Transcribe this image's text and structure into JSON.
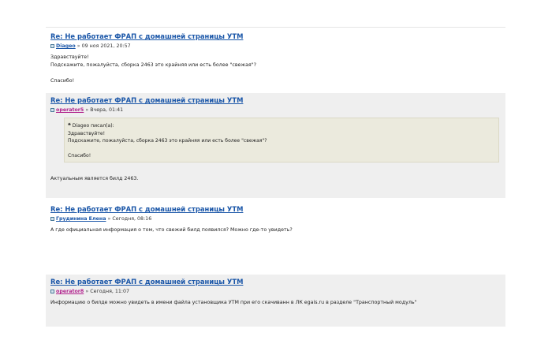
{
  "posts": [
    {
      "title": "Re: Не работает ФРАП с домашней страницы УТМ",
      "author": "Diageo",
      "date_sep": "»",
      "date": "09 ноя 2021, 20:57",
      "body": [
        "Здравствуйте!",
        "Подскажите, пожалуйста, сборка 2463 это крайняя или есть более \"свежая\"?",
        "",
        "Спасибо!"
      ]
    },
    {
      "title": "Re: Не работает ФРАП с домашней страницы УТМ",
      "author": "operator5",
      "date_sep": "»",
      "date": "Вчера, 01:41",
      "quote": {
        "header": "Diageo писал(а):",
        "lines": [
          "Здравствуйте!",
          "Подскажите, пожалуйста, сборка 2463 это крайняя или есть более \"свежая\"?",
          "",
          "Спасибо!"
        ]
      },
      "body": [
        "Актуальным является билд 2463."
      ]
    },
    {
      "title": "Re: Не работает ФРАП с домашней страницы УТМ",
      "author": "Грудинина Елена",
      "date_sep": "»",
      "date": "Сегодня, 08:16",
      "body": [
        "А где официальная информация о том, что свежий билд появился? Можно где-то увидеть?"
      ]
    },
    {
      "title": "Re: Не работает ФРАП с домашней страницы УТМ",
      "author": "operator8",
      "date_sep": "»",
      "date": "Сегодня, 11:07",
      "body": [
        "Информацию о билде можно увидеть в имени файла установщика УТМ при его скачиванн в ЛК egais.ru в разделе \"Транспортный модуль\""
      ]
    }
  ],
  "colors": {
    "link": "#1a56a8",
    "operator_link": "#b0208c",
    "post_bg_alt": "#efefef",
    "quote_bg": "#ebeadd"
  },
  "icons": {
    "post": "post-icon",
    "quote": "quote-icon"
  }
}
